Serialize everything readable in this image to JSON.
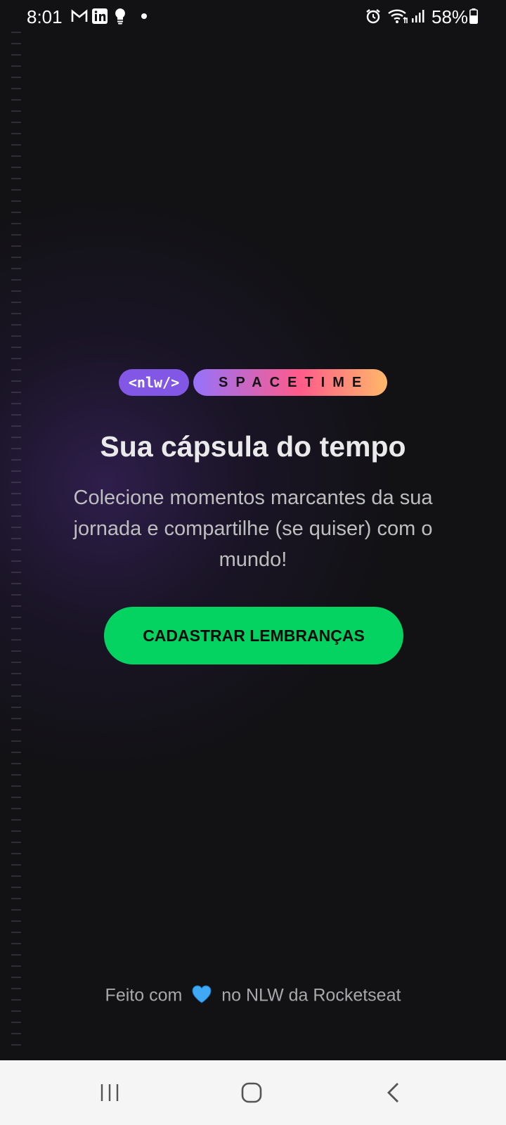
{
  "status_bar": {
    "time": "8:01",
    "battery": "58%",
    "icons": [
      "gmail-icon",
      "linkedin-icon",
      "bulb-icon",
      "dot-icon",
      "alarm-icon",
      "wifi-icon",
      "signal-icon",
      "battery-icon"
    ]
  },
  "logo": {
    "nlw": "<nlw/>",
    "spacetime": "SPACETIME"
  },
  "main": {
    "headline": "Sua cápsula do tempo",
    "description": "Colecione momentos marcantes da sua jornada e compartilhe (se quiser) com o mundo!",
    "cta_label": "CADASTRAR LEMBRANÇAS"
  },
  "footer": {
    "prefix": "Feito com",
    "suffix": "no NLW da Rocketseat"
  },
  "colors": {
    "background": "#121215",
    "cta": "#04d361",
    "purple": "#8257e5"
  }
}
